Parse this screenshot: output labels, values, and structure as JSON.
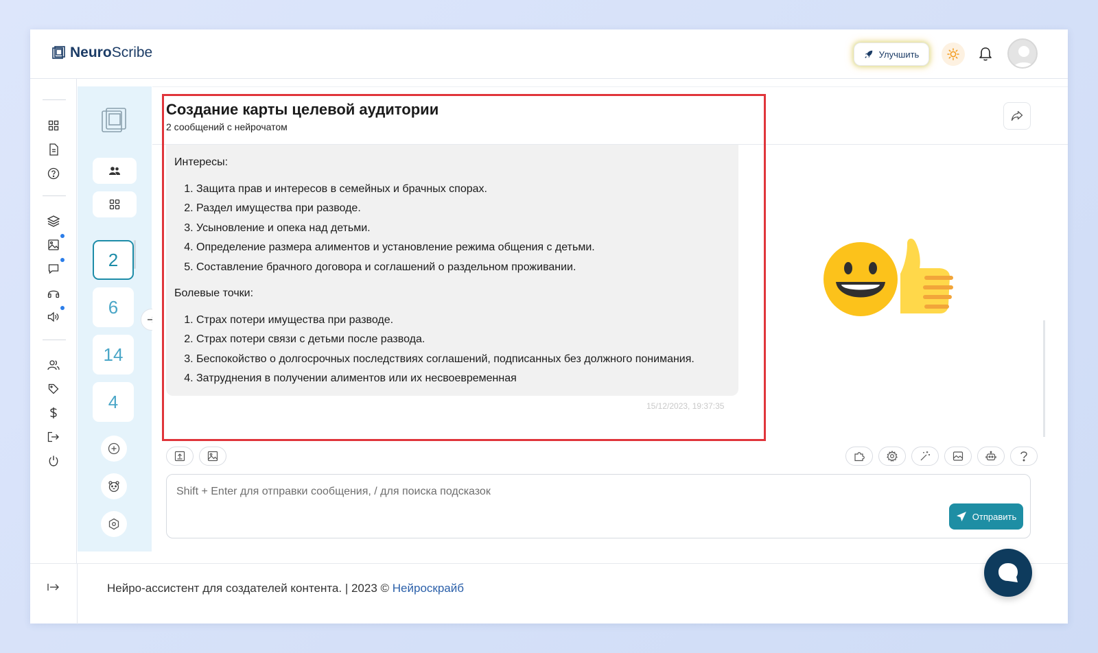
{
  "header": {
    "logo_bold": "Neuro",
    "logo_rest": "Scribe",
    "upgrade_label": "Улучшить"
  },
  "panel2": {
    "chat_counts": [
      "2",
      "6",
      "14",
      "4"
    ]
  },
  "chat": {
    "title": "Создание карты целевой аудитории",
    "subtitle": "2 сообщений с нейрочатом",
    "section1_heading": "Интересы:",
    "section1_items": [
      "Защита прав и интересов в семейных и брачных спорах.",
      "Раздел имущества при разводе.",
      "Усыновление и опека над детьми.",
      "Определение размера алиментов и установление режима общения с детьми.",
      "Составление брачного договора и соглашений о раздельном проживании."
    ],
    "section2_heading": "Болевые точки:",
    "section2_items": [
      "Страх потери имущества при разводе.",
      "Страх потери связи с детьми после развода.",
      "Беспокойство о долгосрочных последствиях соглашений, подписанных без должного понимания.",
      "Затруднения в получении алиментов или их несвоевременная"
    ],
    "timestamp": "15/12/2023, 19:37:35"
  },
  "input": {
    "placeholder": "Shift + Enter для отправки сообщения, / для поиска подсказок",
    "value": "",
    "send_label": "Отправить"
  },
  "footer": {
    "text": "Нейро-ассистент для создателей контента.  | 2023 © ",
    "link": "Нейроскрайб"
  },
  "colors": {
    "accent": "#1e8ea4",
    "brand": "#1c3c66",
    "highlight_frame": "#e0353b"
  }
}
